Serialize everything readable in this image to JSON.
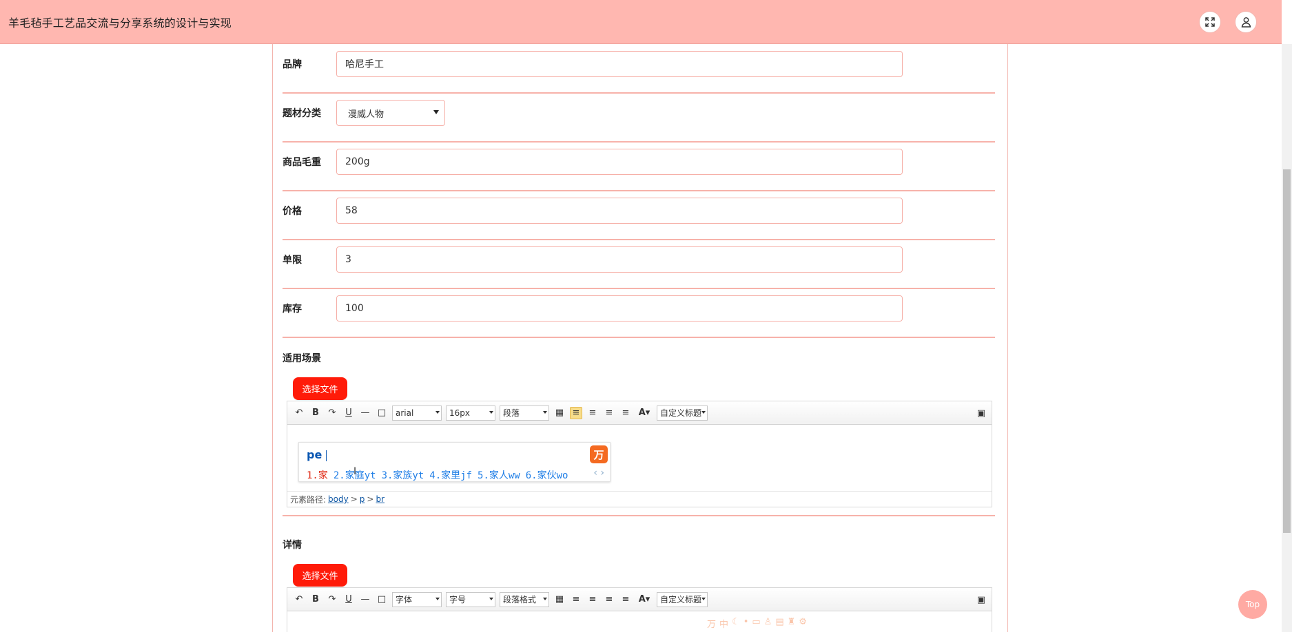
{
  "app": {
    "title": "羊毛毡手工艺品交流与分享系统的设计与实现"
  },
  "header": {
    "fullscreen_icon": "expand-icon",
    "user_icon": "user-icon"
  },
  "form": {
    "brand": {
      "label": "品牌",
      "value": "哈尼手工"
    },
    "category": {
      "label": "题材分类",
      "selected": "漫威人物"
    },
    "weight": {
      "label": "商品毛重",
      "value": "200g"
    },
    "price": {
      "label": "价格",
      "value": "58"
    },
    "limit": {
      "label": "单限",
      "value": "3"
    },
    "stock": {
      "label": "库存",
      "value": "100"
    }
  },
  "scene": {
    "label": "适用场景",
    "file_button": "选择文件",
    "toolbar": {
      "font": "arial",
      "size": "16px",
      "paragraph": "段落",
      "custom_title": "自定义标题"
    },
    "ime": {
      "input": "pe",
      "candidates": [
        "1.家",
        "2.家庭yt",
        "3.家族yt",
        "4.家里jf",
        "5.家人ww",
        "6.家伙wo"
      ],
      "logo": "万"
    },
    "path": {
      "prefix": "元素路径:",
      "body": "body",
      "sep1": ">",
      "p": "p",
      "sep2": ">",
      "br": "br"
    }
  },
  "details": {
    "label": "详情",
    "file_button": "选择文件",
    "toolbar": {
      "font": "字体",
      "size": "字号",
      "paragraph": "段落格式",
      "custom_title": "自定义标题"
    }
  },
  "top_button": "Top"
}
